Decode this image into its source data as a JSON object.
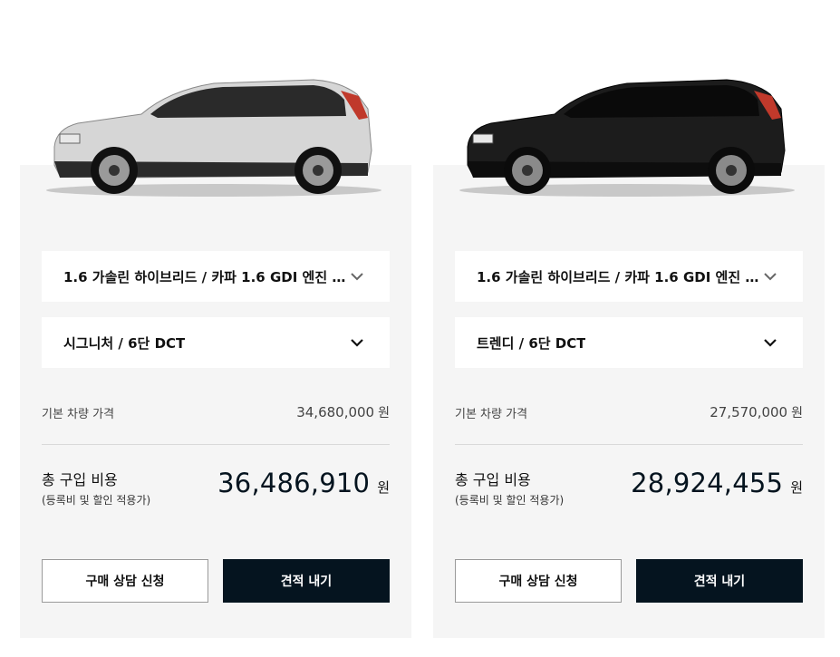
{
  "cards": [
    {
      "car_color": "#d6d6d6",
      "car_accent": "#bfbfbf",
      "powertrain_label": "1.6 가솔린 하이브리드 / 카파 1.6 GDI 엔진 ...",
      "trim_label": "시그니처 / 6단 DCT",
      "base_price_label": "기본 차량 가격",
      "base_price_value": "34,680,000",
      "currency_unit": "원",
      "total_label": "총 구입 비용",
      "total_note": "(등록비 및 할인 적용가)",
      "total_value": "36,486,910",
      "consult_button": "구매 상담 신청",
      "quote_button": "견적 내기"
    },
    {
      "car_color": "#1c1c1c",
      "car_accent": "#0d0d0d",
      "powertrain_label": "1.6 가솔린 하이브리드 / 카파 1.6 GDI 엔진 ...",
      "trim_label": "트렌디 / 6단 DCT",
      "base_price_label": "기본 차량 가격",
      "base_price_value": "27,570,000",
      "currency_unit": "원",
      "total_label": "총 구입 비용",
      "total_note": "(등록비 및 할인 적용가)",
      "total_value": "28,924,455",
      "consult_button": "구매 상담 신청",
      "quote_button": "견적 내기"
    }
  ]
}
